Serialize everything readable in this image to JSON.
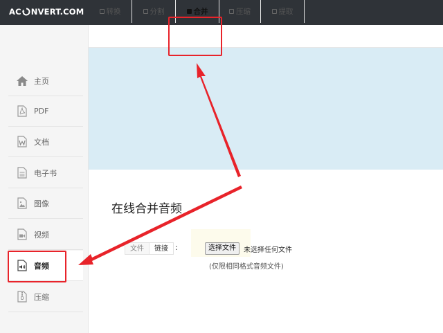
{
  "brand": {
    "logo_left": "AC",
    "logo_right": "NVERT.COM"
  },
  "tabs": [
    {
      "label": "转换",
      "active": false
    },
    {
      "label": "分割",
      "active": false
    },
    {
      "label": "合并",
      "active": true
    },
    {
      "label": "压缩",
      "active": false
    },
    {
      "label": "提取",
      "active": false
    }
  ],
  "sidebar": {
    "items": [
      {
        "label": "主页",
        "icon": "home-icon"
      },
      {
        "label": "PDF",
        "icon": "pdf-file-icon"
      },
      {
        "label": "文档",
        "icon": "word-file-icon"
      },
      {
        "label": "电子书",
        "icon": "ebook-file-icon"
      },
      {
        "label": "图像",
        "icon": "image-file-icon"
      },
      {
        "label": "视频",
        "icon": "video-file-icon"
      },
      {
        "label": "音频",
        "icon": "audio-file-icon",
        "active": true
      },
      {
        "label": "压缩",
        "icon": "archive-file-icon"
      }
    ]
  },
  "main": {
    "heading": "在线合并音频",
    "source_modes": [
      "文件",
      "链接"
    ],
    "active_mode": "链接",
    "colon": ":",
    "file_button": "选择文件",
    "file_status": "未选择任何文件",
    "hint": "(仅限相同格式音频文件)"
  },
  "colors": {
    "topbar": "#2f3338",
    "banner": "#d9ecf5",
    "annotation": "#e8232a"
  }
}
